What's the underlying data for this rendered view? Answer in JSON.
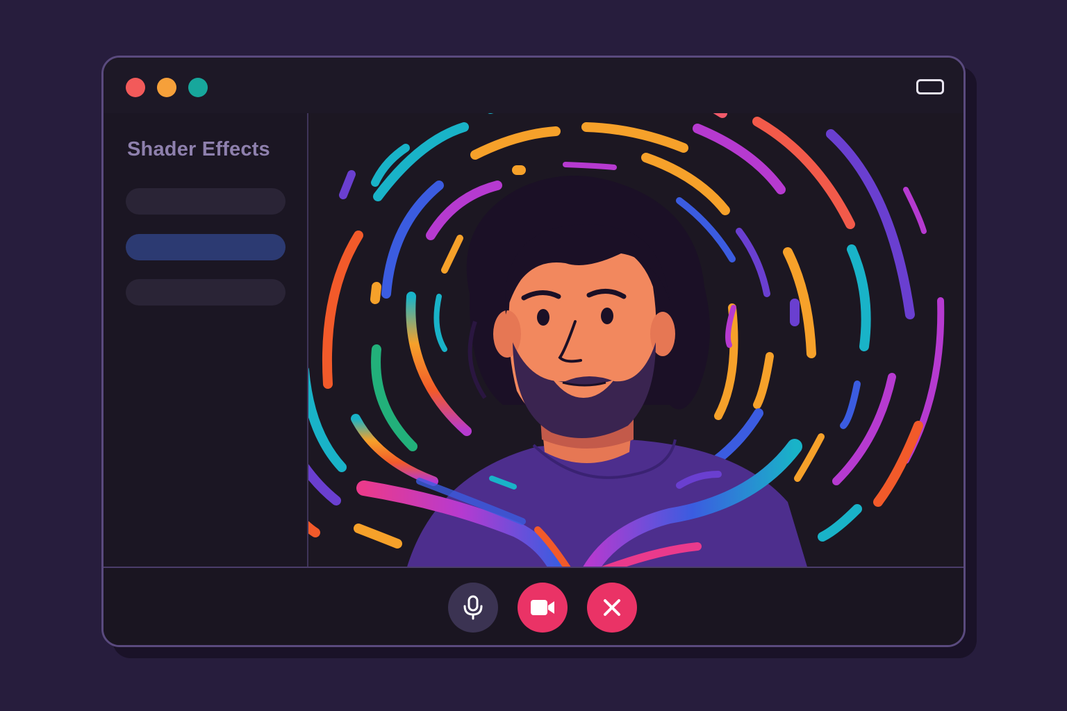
{
  "window": {
    "title_bar": {
      "traffic_lights": [
        {
          "name": "close",
          "color": "#f25a5a"
        },
        {
          "name": "minimize",
          "color": "#f6a03a"
        },
        {
          "name": "zoom",
          "color": "#17a79c"
        }
      ],
      "maximize_icon": "window-maximize-icon"
    }
  },
  "sidebar": {
    "title": "Shader Effects",
    "items": [
      {
        "label": "",
        "selected": false
      },
      {
        "label": "",
        "selected": true
      },
      {
        "label": "",
        "selected": false
      }
    ]
  },
  "video": {
    "subject": "person",
    "effect_colors": [
      "#19b3c8",
      "#f6a12a",
      "#f25a2a",
      "#b63ad0",
      "#3b5ce0",
      "#6a3fd0",
      "#22b07a"
    ]
  },
  "controls": {
    "mic": {
      "icon": "microphone-icon",
      "color": "#3b3352"
    },
    "camera": {
      "icon": "video-camera-icon",
      "color": "#ea3366"
    },
    "end_call": {
      "icon": "close-icon",
      "color": "#ea3366"
    }
  }
}
